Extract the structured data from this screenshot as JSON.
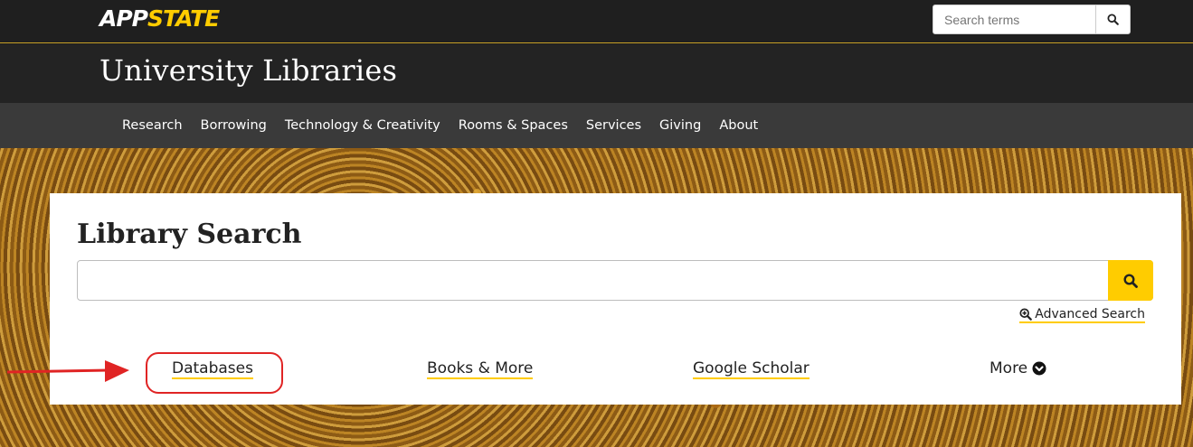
{
  "header": {
    "logo_app": "APP",
    "logo_state": "STATE",
    "search_placeholder": "Search terms",
    "site_title": "University Libraries"
  },
  "nav": {
    "items": [
      "Research",
      "Borrowing",
      "Technology & Creativity",
      "Rooms & Spaces",
      "Services",
      "Giving",
      "About"
    ]
  },
  "library_search": {
    "title": "Library Search",
    "input_value": "",
    "advanced_label": "Advanced Search",
    "links": {
      "databases": "Databases",
      "books": "Books & More",
      "scholar": "Google Scholar",
      "more": "More"
    }
  },
  "colors": {
    "accent": "#ffcc00",
    "annotation": "#e02424"
  }
}
